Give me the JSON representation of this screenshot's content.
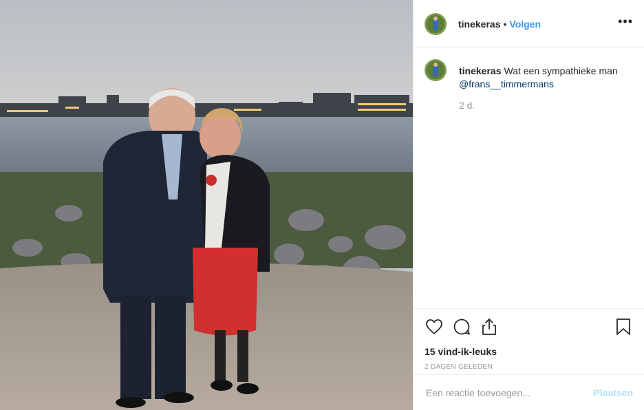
{
  "post": {
    "image_alt": "Two people posing together in front of a river at dusk"
  },
  "header": {
    "username": "tinekeras",
    "separator": "•",
    "follow_label": "Volgen",
    "more_label": "•••"
  },
  "caption": {
    "username": "tinekeras",
    "text": "Wat een sympathieke man",
    "mention": "@frans__timmermans",
    "time": "2 d."
  },
  "actions": {
    "like_icon": "heart-icon",
    "comment_icon": "comment-bubble-icon",
    "share_icon": "share-icon",
    "save_icon": "bookmark-icon",
    "likes": "15 vind-ik-leuks",
    "date": "2 DAGEN GELEDEN"
  },
  "add_comment": {
    "placeholder": "Een reactie toevoegen...",
    "post_label": "Plaatsen"
  },
  "colors": {
    "accent": "#3897f0",
    "post_disabled": "#b2dffc",
    "muted": "#999999"
  }
}
